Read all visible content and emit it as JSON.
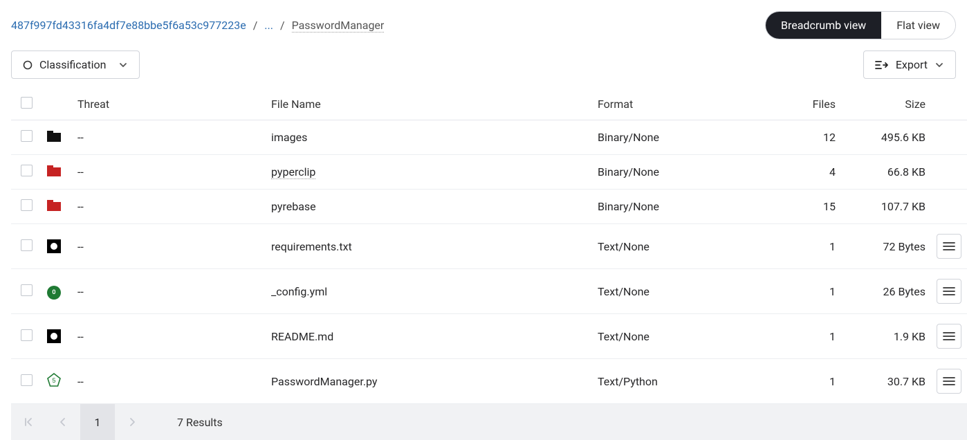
{
  "breadcrumb": {
    "hash": "487f997fd43316fa4df7e88bbe5f6a53c977223e",
    "ellipsis": "...",
    "current": "PasswordManager"
  },
  "view_toggle": {
    "breadcrumb_view": "Breadcrumb view",
    "flat_view": "Flat view"
  },
  "filters": {
    "classification_label": "Classification",
    "export_label": "Export"
  },
  "table": {
    "headers": {
      "threat": "Threat",
      "file_name": "File Name",
      "format": "Format",
      "files": "Files",
      "size": "Size"
    },
    "rows": [
      {
        "icon": "folder-black",
        "threat": "--",
        "name": "images",
        "link": false,
        "format": "Binary/None",
        "files": "12",
        "size": "495.6 KB",
        "actions": false
      },
      {
        "icon": "folder-red",
        "threat": "--",
        "name": "pyperclip",
        "link": true,
        "format": "Binary/None",
        "files": "4",
        "size": "66.8 KB",
        "actions": false
      },
      {
        "icon": "folder-red",
        "threat": "--",
        "name": "pyrebase",
        "link": false,
        "format": "Binary/None",
        "files": "15",
        "size": "107.7 KB",
        "actions": false
      },
      {
        "icon": "square-dot",
        "threat": "--",
        "name": "requirements.txt",
        "link": false,
        "format": "Text/None",
        "files": "1",
        "size": "72 Bytes",
        "actions": true
      },
      {
        "icon": "green-circle",
        "badge": "0",
        "threat": "--",
        "name": "_config.yml",
        "link": false,
        "format": "Text/None",
        "files": "1",
        "size": "26 Bytes",
        "actions": true
      },
      {
        "icon": "square-dot",
        "threat": "--",
        "name": "README.md",
        "link": false,
        "format": "Text/None",
        "files": "1",
        "size": "1.9 KB",
        "actions": true
      },
      {
        "icon": "pentagon-5",
        "badge": "5",
        "threat": "--",
        "name": "PasswordManager.py",
        "link": false,
        "format": "Text/Python",
        "files": "1",
        "size": "30.7 KB",
        "actions": true
      }
    ]
  },
  "pager": {
    "page": "1",
    "results": "7 Results"
  }
}
